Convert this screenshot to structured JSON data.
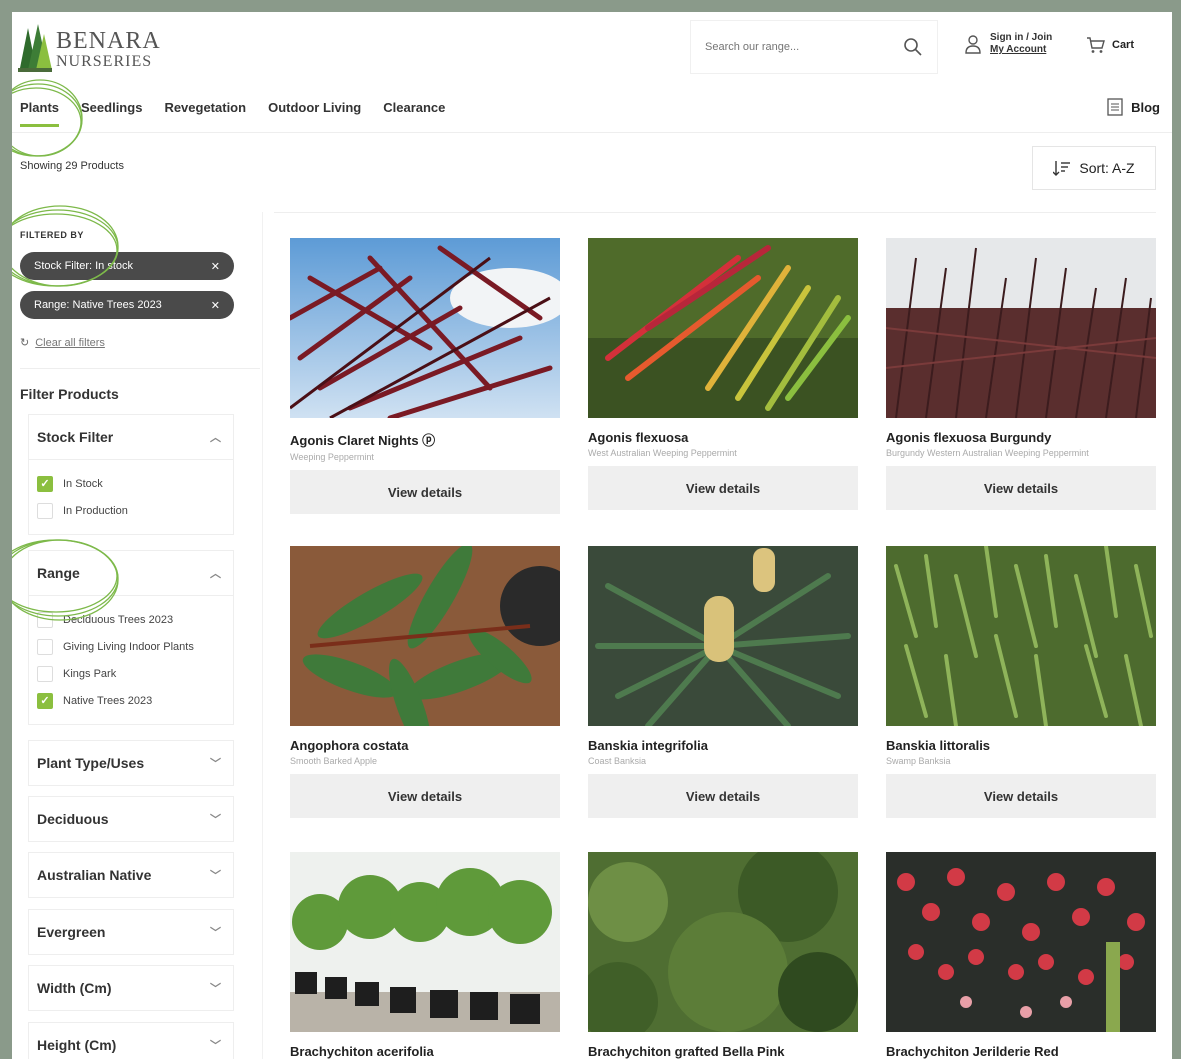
{
  "brand": {
    "line1": "BENARA",
    "line2": "NURSERIES"
  },
  "header": {
    "search_placeholder": "Search our range...",
    "sign_in": "Sign in / Join",
    "my_account": "My Account",
    "cart": "Cart"
  },
  "nav": {
    "items": [
      "Plants",
      "Seedlings",
      "Revegetation",
      "Outdoor Living",
      "Clearance"
    ],
    "blog": "Blog"
  },
  "results": {
    "showing": "Showing 29 Products",
    "sort": "Sort: A-Z"
  },
  "filters": {
    "title": "FILTERED BY",
    "chips": [
      "Stock Filter: In stock",
      "Range: Native Trees 2023"
    ],
    "clear": "Clear all filters",
    "heading": "Filter Products",
    "stock": {
      "label": "Stock Filter",
      "options": [
        {
          "label": "In Stock",
          "checked": true
        },
        {
          "label": "In Production",
          "checked": false
        }
      ]
    },
    "range": {
      "label": "Range",
      "options": [
        {
          "label": "Deciduous Trees 2023",
          "checked": false
        },
        {
          "label": "Giving Living Indoor Plants",
          "checked": false
        },
        {
          "label": "Kings Park",
          "checked": false
        },
        {
          "label": "Native Trees 2023",
          "checked": true
        }
      ]
    },
    "collapsed": [
      "Plant Type/Uses",
      "Deciduous",
      "Australian Native",
      "Evergreen",
      "Width (Cm)",
      "Height (Cm)"
    ]
  },
  "products": [
    {
      "name": "Agonis Claret Nights ⓟ",
      "sub": "Weeping Peppermint",
      "button": "View details"
    },
    {
      "name": "Agonis flexuosa",
      "sub": "West Australian Weeping Peppermint",
      "button": "View details"
    },
    {
      "name": "Agonis flexuosa Burgundy",
      "sub": "Burgundy Western Australian Weeping Peppermint",
      "button": "View details"
    },
    {
      "name": "Angophora costata",
      "sub": "Smooth Barked Apple",
      "button": "View details"
    },
    {
      "name": "Banskia integrifolia",
      "sub": "Coast Banksia",
      "button": "View details"
    },
    {
      "name": "Banskia littoralis",
      "sub": "Swamp Banksia",
      "button": "View details"
    },
    {
      "name": "Brachychiton acerifolia",
      "sub": "",
      "button": ""
    },
    {
      "name": "Brachychiton grafted Bella Pink",
      "sub": "",
      "button": ""
    },
    {
      "name": "Brachychiton Jerilderie Red",
      "sub": "",
      "button": ""
    }
  ],
  "colors": {
    "accent": "#8bbf3f",
    "chip": "#4a4a4a",
    "frame": "#8a9a8a"
  }
}
